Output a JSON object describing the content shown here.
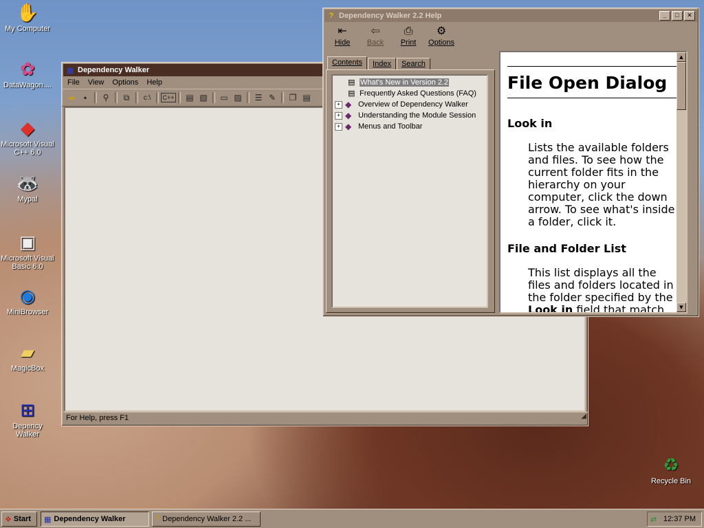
{
  "desktop": {
    "icons": [
      {
        "label": "My Computer",
        "icon": "hand-icon",
        "glyph": "✋"
      },
      {
        "label": "DataWagon....",
        "icon": "flower-icon",
        "glyph": "✿"
      },
      {
        "label": "Microsoft Visual C++ 6.0",
        "icon": "vc-icon",
        "glyph": "◆"
      },
      {
        "label": "Mypal",
        "icon": "raccoon-icon",
        "glyph": "🦝"
      },
      {
        "label": "Microsoft Visual Basic 6.0",
        "icon": "vb-icon",
        "glyph": "▣"
      },
      {
        "label": "MiniBrowser",
        "icon": "globe-icon",
        "glyph": "◉"
      },
      {
        "label": "MagicBox",
        "icon": "folder-icon",
        "glyph": "📁"
      },
      {
        "label": "Depency Walker",
        "icon": "depends-icon",
        "glyph": "⊞"
      },
      {
        "label": "Recycle Bin",
        "icon": "recycle-icon",
        "glyph": "♻"
      }
    ]
  },
  "depwalker": {
    "title": "Dependency Walker",
    "menu": [
      "File",
      "View",
      "Options",
      "Help"
    ],
    "status": "For Help, press F1"
  },
  "help": {
    "title": "Dependency Walker 2.2 Help",
    "buttons": [
      {
        "label": "Hide",
        "glyph": "⇤"
      },
      {
        "label": "Back",
        "glyph": "⇦"
      },
      {
        "label": "Print",
        "glyph": "⎙"
      },
      {
        "label": "Options",
        "glyph": "⚙"
      }
    ],
    "tabs": [
      "Contents",
      "Index",
      "Search"
    ],
    "tree": [
      {
        "label": "What's New in Version 2.2",
        "type": "page",
        "selected": true
      },
      {
        "label": "Frequently Asked Questions (FAQ)",
        "type": "page"
      },
      {
        "label": "Overview of Dependency Walker",
        "type": "book"
      },
      {
        "label": "Understanding the Module Session",
        "type": "book"
      },
      {
        "label": "Menus and Toolbar",
        "type": "book"
      }
    ],
    "content": {
      "heading": "File Open Dialog",
      "section1_title": "Look in",
      "section1_text": "Lists the available folders and files. To see how the current folder fits in the hierarchy on your computer, click the down arrow. To see what's inside a folder, click it.",
      "section2_title": "File and Folder List",
      "section2_text_a": "This list displays all the files and folders located in the folder specified by the",
      "section2_bold": "Look in",
      "section2_text_b": "field that match"
    }
  },
  "taskbar": {
    "start": "Start",
    "tasks": [
      "Dependency Walker",
      "Dependency Walker 2.2 ..."
    ],
    "clock": "12:37 PM"
  }
}
